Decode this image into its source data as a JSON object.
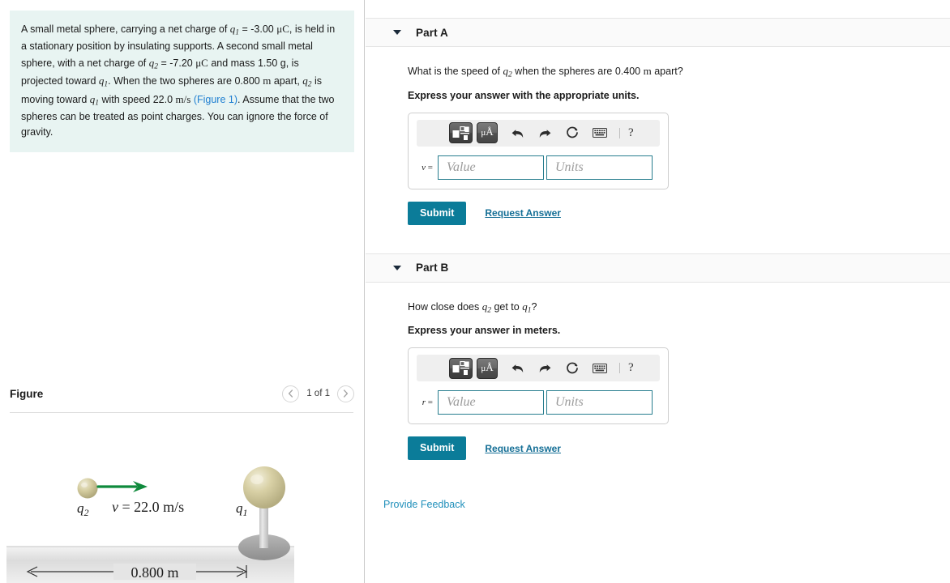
{
  "problem": {
    "text_segments": [
      {
        "t": "A small metal sphere, carrying a net charge of ",
        "k": "plain"
      },
      {
        "t": "q1",
        "k": "var"
      },
      {
        "t": " = -3.00 ",
        "k": "plain"
      },
      {
        "t": "μC",
        "k": "unit"
      },
      {
        "t": ", is held in a stationary position by insulating supports. A second small metal sphere, with a net charge of ",
        "k": "plain"
      },
      {
        "t": "q2",
        "k": "var"
      },
      {
        "t": " = -7.20 ",
        "k": "plain"
      },
      {
        "t": "μC",
        "k": "unit"
      },
      {
        "t": " and mass 1.50 g, is projected toward ",
        "k": "plain"
      },
      {
        "t": "q1",
        "k": "var"
      },
      {
        "t": ". When the two spheres are 0.800 ",
        "k": "plain"
      },
      {
        "t": "m",
        "k": "unit"
      },
      {
        "t": " apart, ",
        "k": "plain"
      },
      {
        "t": "q2",
        "k": "var"
      },
      {
        "t": " is moving toward ",
        "k": "plain"
      },
      {
        "t": "q1",
        "k": "var"
      },
      {
        "t": " with speed 22.0 ",
        "k": "plain"
      },
      {
        "t": "m/s",
        "k": "unit"
      },
      {
        "t": " ",
        "k": "plain"
      },
      {
        "t": "(Figure 1)",
        "k": "link"
      },
      {
        "t": ". Assume that the two spheres can be treated as point charges. You can ignore the force of gravity.",
        "k": "plain"
      }
    ],
    "full_text": "A small metal sphere, carrying a net charge of q1 = -3.00 μC, is held in a stationary position by insulating supports. A second small metal sphere, with a net charge of q2 = -7.20 μC and mass 1.50 g, is projected toward q1. When the two spheres are 0.800 m apart, q2 is moving toward q1 with speed 22.0 m/s (Figure 1). Assume that the two spheres can be treated as point charges. You can ignore the force of gravity.",
    "figure_link_label": "(Figure 1)",
    "background_color": "#e8f4f2",
    "link_color": "#1f7fd1"
  },
  "figure": {
    "title": "Figure",
    "counter": "1 of 1",
    "prev_icon": "chevron-left-icon",
    "next_icon": "chevron-right-icon",
    "labels": {
      "charge_left": "q2",
      "charge_right": "q1",
      "velocity": "v = 22.0 m/s",
      "distance": "0.800 m"
    },
    "arrow_color": "#0f8a3c",
    "sphere_color": "#cfc79a"
  },
  "parts": [
    {
      "id": "part-a",
      "label": "Part A",
      "caret_icon": "caret-down-icon",
      "question_segments": [
        {
          "t": "What is the speed of ",
          "k": "plain"
        },
        {
          "t": "q2",
          "k": "var"
        },
        {
          "t": " when the spheres are 0.400 ",
          "k": "plain"
        },
        {
          "t": "m",
          "k": "unit"
        },
        {
          "t": " apart?",
          "k": "plain"
        }
      ],
      "question_text": "What is the speed of q2 when the spheres are 0.400 m apart?",
      "express": "Express your answer with the appropriate units.",
      "variable": "v",
      "value_placeholder": "Value",
      "units_placeholder": "Units",
      "value": "",
      "units": "",
      "submit_label": "Submit",
      "request_answer_label": "Request Answer",
      "toolbar": {
        "template_icon": "math-template-icon",
        "units_icon": "micro-angstrom-units-icon",
        "units_label": "μÅ",
        "undo_icon": "undo-arrow-icon",
        "redo_icon": "redo-arrow-icon",
        "reset_icon": "reset-circular-arrow-icon",
        "keyboard_icon": "keyboard-icon",
        "help_icon": "question-mark-help-icon",
        "help_label": "?"
      }
    },
    {
      "id": "part-b",
      "label": "Part B",
      "caret_icon": "caret-down-icon",
      "question_segments": [
        {
          "t": "How close does ",
          "k": "plain"
        },
        {
          "t": "q2",
          "k": "var"
        },
        {
          "t": " get to ",
          "k": "plain"
        },
        {
          "t": "q1",
          "k": "var"
        },
        {
          "t": "?",
          "k": "plain"
        }
      ],
      "question_text": "How close does q2 get to q1?",
      "express": "Express your answer in meters.",
      "variable": "r",
      "value_placeholder": "Value",
      "units_placeholder": "Units",
      "value": "",
      "units": "",
      "submit_label": "Submit",
      "request_answer_label": "Request Answer",
      "toolbar": {
        "template_icon": "math-template-icon",
        "units_icon": "micro-angstrom-units-icon",
        "units_label": "μÅ",
        "undo_icon": "undo-arrow-icon",
        "redo_icon": "redo-arrow-icon",
        "reset_icon": "reset-circular-arrow-icon",
        "keyboard_icon": "keyboard-icon",
        "help_icon": "question-mark-help-icon",
        "help_label": "?"
      }
    }
  ],
  "footer": {
    "provide_feedback_label": "Provide Feedback",
    "link_color": "#1f8fba"
  },
  "colors": {
    "submit_bg": "#0b7c99",
    "field_border": "#277d8e",
    "band_bg": "#fafafa"
  }
}
